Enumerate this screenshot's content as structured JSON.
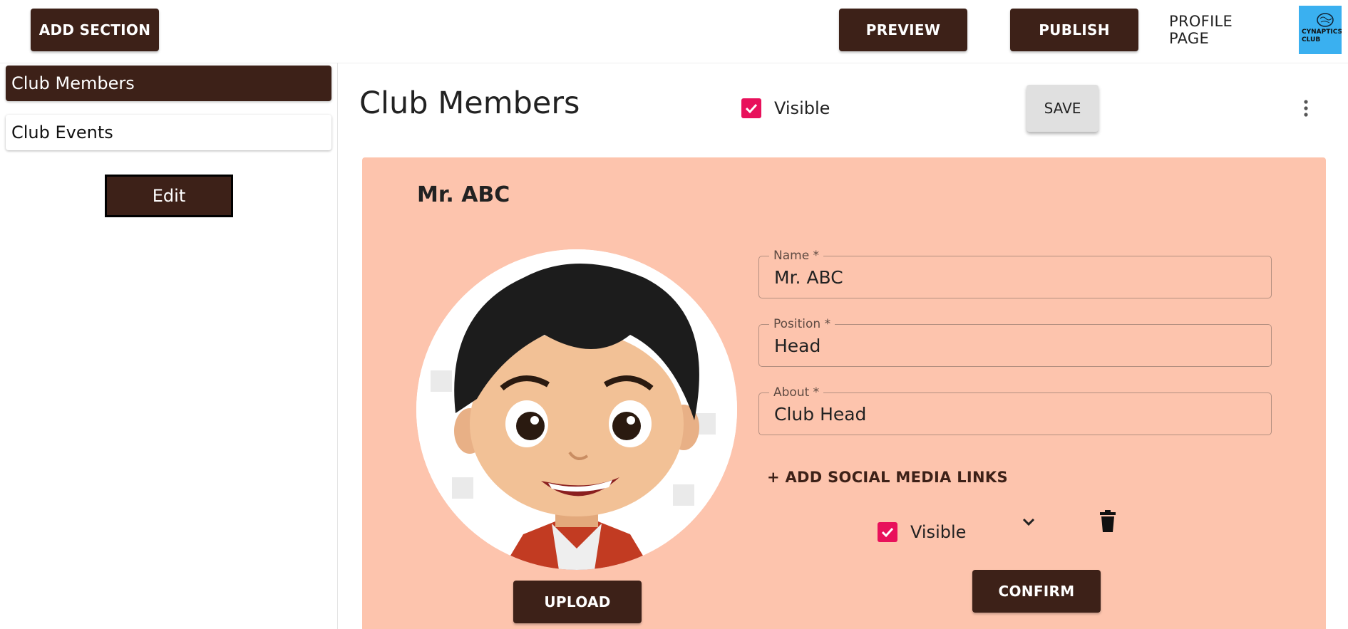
{
  "topbar": {
    "add_section": "ADD SECTION",
    "preview": "PREVIEW",
    "publish": "PUBLISH",
    "profile_page": "PROFILE PAGE",
    "logo_text_line1": "CYNAPTICS",
    "logo_text_line2": "CLUB"
  },
  "sidebar": {
    "items": [
      {
        "label": "Club Members",
        "active": true
      },
      {
        "label": "Club Events",
        "active": false
      }
    ],
    "edit_label": "Edit"
  },
  "section": {
    "title": "Club Members",
    "visible_label": "Visible",
    "visible_checked": true,
    "save_label": "SAVE",
    "menu_icon": "more-vert-icon"
  },
  "member": {
    "heading": "Mr. ABC",
    "fields": {
      "name": {
        "label": "Name *",
        "value": "Mr. ABC"
      },
      "position": {
        "label": "Position *",
        "value": "Head"
      },
      "about": {
        "label": "About *",
        "value": "Club Head"
      }
    },
    "add_social_label": "+ ADD SOCIAL MEDIA LINKS",
    "visible_label": "Visible",
    "visible_checked": true,
    "upload_label": "UPLOAD",
    "confirm_label": "CONFIRM"
  },
  "colors": {
    "brand_dark": "#3d2118",
    "card_bg": "#fdc4ad",
    "checkbox": "#e8115b",
    "logo_bg": "#3ab0f0"
  }
}
